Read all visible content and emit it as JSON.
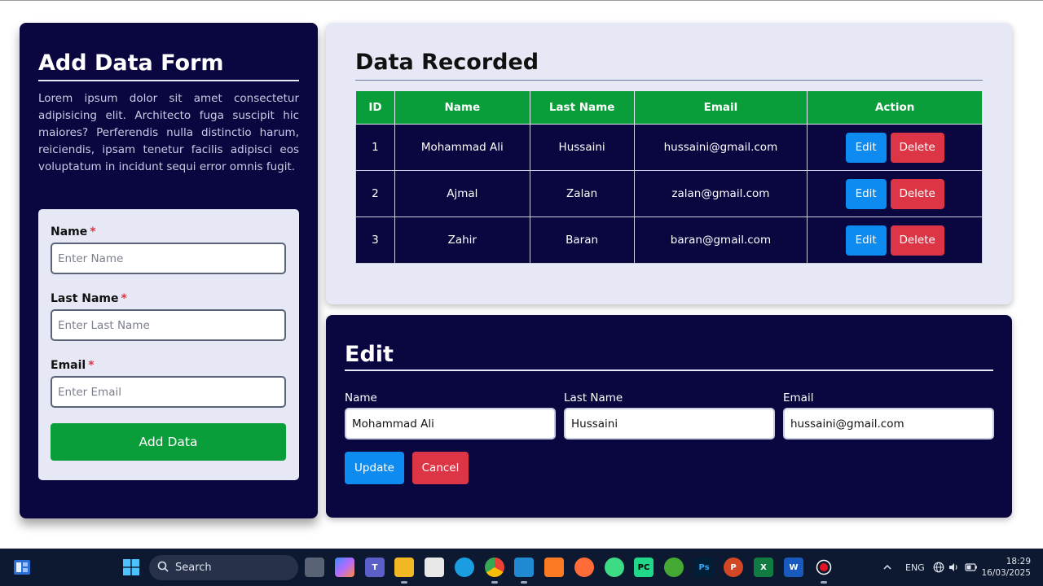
{
  "add_form": {
    "title": "Add Data Form",
    "description": "Lorem ipsum dolor sit amet consectetur adipisicing elit. Architecto fuga suscipit hic maiores? Perferendis nulla distinctio harum, reiciendis, ipsam tenetur facilis adipisci eos voluptatum in incidunt sequi error omnis fugit.",
    "required_marker": "*",
    "name_label": "Name",
    "name_placeholder": "Enter Name",
    "last_name_label": "Last Name",
    "last_name_placeholder": "Enter Last Name",
    "email_label": "Email",
    "email_placeholder": "Enter Email",
    "submit_label": "Add Data"
  },
  "records": {
    "title": "Data Recorded",
    "columns": [
      "ID",
      "Name",
      "Last Name",
      "Email",
      "Action"
    ],
    "rows": [
      {
        "id": "1",
        "name": "Mohammad Ali",
        "last_name": "Hussaini",
        "email": "hussaini@gmail.com"
      },
      {
        "id": "2",
        "name": "Ajmal",
        "last_name": "Zalan",
        "email": "zalan@gmail.com"
      },
      {
        "id": "3",
        "name": "Zahir",
        "last_name": "Baran",
        "email": "baran@gmail.com"
      }
    ],
    "edit_label": "Edit",
    "delete_label": "Delete"
  },
  "edit_form": {
    "title": "Edit",
    "name_label": "Name",
    "name_value": "Mohammad Ali",
    "last_name_label": "Last Name",
    "last_name_value": "Hussaini",
    "email_label": "Email",
    "email_value": "hussaini@gmail.com",
    "update_label": "Update",
    "cancel_label": "Cancel"
  },
  "taskbar": {
    "search_label": "Search",
    "language": "ENG",
    "time": "18:29",
    "date": "16/03/2025",
    "apps": [
      "task-view",
      "copilot",
      "teams",
      "file-explorer",
      "microsoft-store",
      "edge",
      "chrome",
      "vs-code",
      "xampp",
      "postman",
      "android-studio",
      "pycharm",
      "anaconda",
      "photoshop",
      "powerpoint",
      "excel",
      "word",
      "screen-recorder"
    ]
  },
  "colors": {
    "navy": "#0a0640",
    "light_panel": "#e6e9f5",
    "green": "#0a9e3a",
    "blue": "#0d8bf0",
    "red": "#dc3545"
  }
}
